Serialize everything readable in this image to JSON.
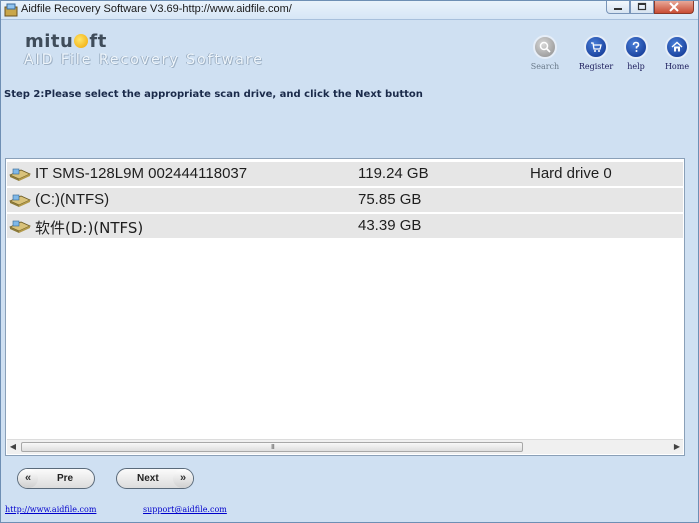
{
  "window": {
    "title": "Aidfile Recovery Software V3.69-http://www.aidfile.com/",
    "controls": [
      "minimize",
      "maximize",
      "close"
    ]
  },
  "logo": {
    "brand_part1": "mitu",
    "brand_part2": "ft",
    "subtitle": "AID File Recovery Software"
  },
  "toolbar": {
    "items": [
      {
        "label": "Search",
        "icon": "search-icon",
        "enabled": false
      },
      {
        "label": "Register",
        "icon": "cart-icon",
        "enabled": true
      },
      {
        "label": "help",
        "icon": "help-icon",
        "enabled": true
      },
      {
        "label": "Home",
        "icon": "home-icon",
        "enabled": true
      }
    ]
  },
  "step_text": "Step 2:Please select the appropriate scan drive, and click the Next button",
  "drives": [
    {
      "name": "IT SMS-128L9M   002444118037",
      "size": "119.24 GB",
      "type": "Hard drive 0"
    },
    {
      "name": "(C:)(NTFS)",
      "size": "75.85 GB",
      "type": ""
    },
    {
      "name": "软件(D:)(NTFS)",
      "size": "43.39 GB",
      "type": ""
    }
  ],
  "scrollbar": {
    "grip": "III"
  },
  "nav": {
    "prev_label": "Pre",
    "prev_chevron": "«",
    "next_label": "Next",
    "next_chevron": "»"
  },
  "footer": {
    "website": "http://www.aidfile.com",
    "email": "support@aidfile.com"
  }
}
